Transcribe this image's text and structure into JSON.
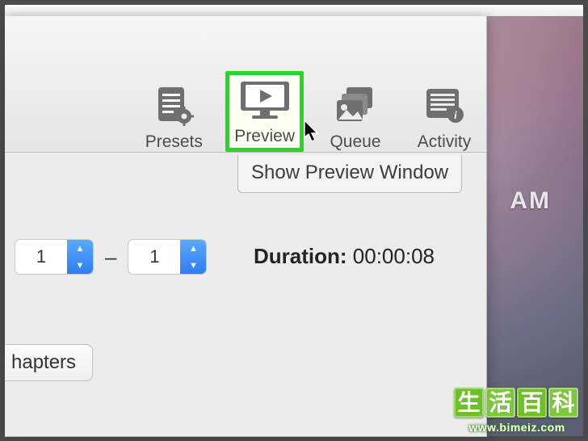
{
  "toolbar": {
    "presets": {
      "label": "Presets"
    },
    "preview": {
      "label": "Preview"
    },
    "queue": {
      "label": "Queue"
    },
    "activity": {
      "label": "Activity"
    },
    "tooltip": "Show Preview Window"
  },
  "stepper": {
    "from": "1",
    "to": "1",
    "sep": "–"
  },
  "duration": {
    "label": "Duration:",
    "value": "00:00:08"
  },
  "chapters": {
    "label": "hapters"
  },
  "desktop": {
    "clock_ampm": "AM"
  },
  "watermark": {
    "chars": [
      "生",
      "活",
      "百",
      "科"
    ],
    "url": "www.bimeiz.com"
  }
}
